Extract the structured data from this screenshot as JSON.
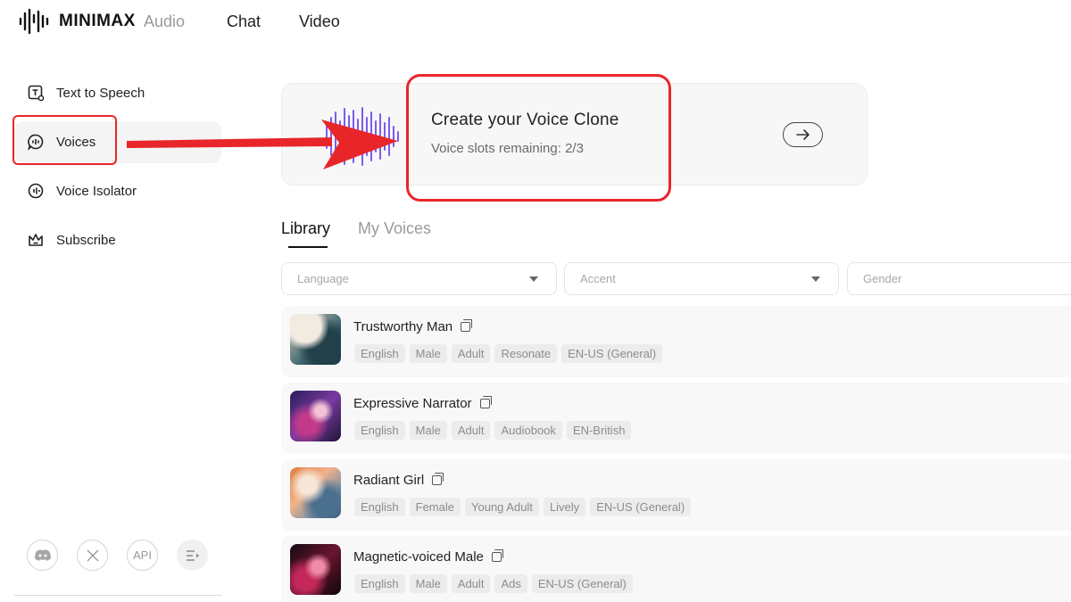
{
  "topnav": {
    "logo_text": "MINIMAX",
    "items": [
      {
        "label": "Audio",
        "active": true
      },
      {
        "label": "Chat"
      },
      {
        "label": "Video"
      }
    ]
  },
  "sidebar": {
    "items": [
      {
        "label": "Text to Speech",
        "icon": "text-to-speech-icon"
      },
      {
        "label": "Voices",
        "icon": "voices-icon",
        "selected": true
      },
      {
        "label": "Voice Isolator",
        "icon": "voice-isolator-icon"
      },
      {
        "label": "Subscribe",
        "icon": "crown-icon"
      }
    ],
    "social": [
      "discord-icon",
      "x-icon",
      "API",
      "menu-icon"
    ]
  },
  "clone_card": {
    "title": "Create your Voice Clone",
    "subtitle": "Voice slots remaining: 2/3"
  },
  "tabs": [
    {
      "label": "Library",
      "active": true
    },
    {
      "label": "My Voices"
    }
  ],
  "filters": {
    "language": "Language",
    "accent": "Accent",
    "gender": "Gender"
  },
  "voices": [
    {
      "name": "Trustworthy Man",
      "tags": [
        "English",
        "Male",
        "Adult",
        "Resonate",
        "EN-US (General)"
      ]
    },
    {
      "name": "Expressive Narrator",
      "tags": [
        "English",
        "Male",
        "Adult",
        "Audiobook",
        "EN-British"
      ]
    },
    {
      "name": "Radiant Girl",
      "tags": [
        "English",
        "Female",
        "Young Adult",
        "Lively",
        "EN-US (General)"
      ]
    },
    {
      "name": "Magnetic-voiced Male",
      "tags": [
        "English",
        "Male",
        "Adult",
        "Ads",
        "EN-US (General)"
      ]
    }
  ],
  "colors": {
    "annotation_red": "#e8262a",
    "wave_purple": "#7b5cf0"
  }
}
